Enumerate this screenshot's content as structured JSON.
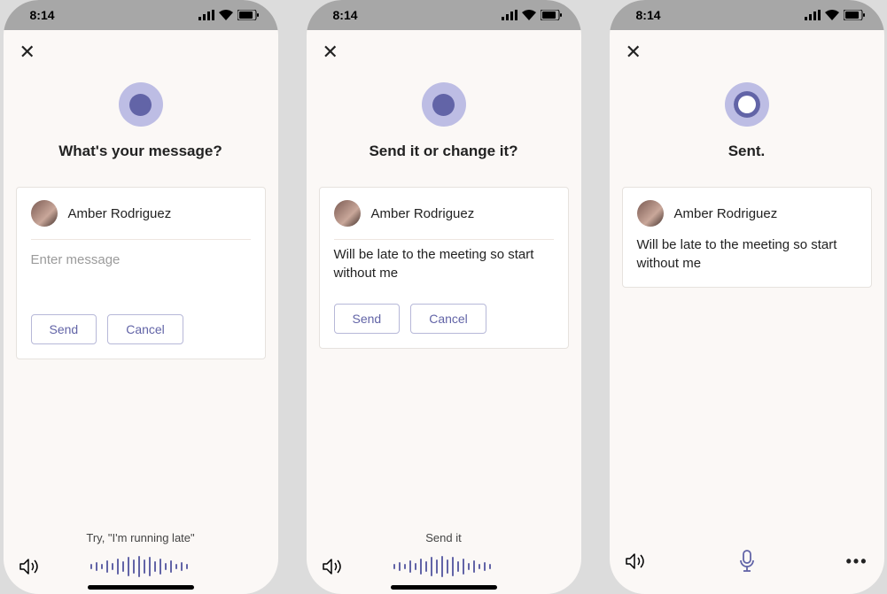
{
  "statusbar": {
    "time": "8:14"
  },
  "screens": [
    {
      "prompt": "What's your message?",
      "recipient": "Amber Rodriguez",
      "placeholder": "Enter message",
      "message": "",
      "send_label": "Send",
      "cancel_label": "Cancel",
      "hint": "Try, \"I'm running late\"",
      "cortana_state": "listening",
      "show_actions": true,
      "show_wave": true,
      "show_mic": false,
      "show_more": false
    },
    {
      "prompt": "Send it or change it?",
      "recipient": "Amber Rodriguez",
      "message": "Will be late to the meeting so start without me",
      "send_label": "Send",
      "cancel_label": "Cancel",
      "hint": "Send it",
      "cortana_state": "listening",
      "show_actions": true,
      "show_wave": true,
      "show_mic": false,
      "show_more": false
    },
    {
      "prompt": "Sent.",
      "recipient": "Amber Rodriguez",
      "message": "Will be late to the meeting so start without me",
      "hint": "",
      "cortana_state": "idle",
      "show_actions": false,
      "show_wave": false,
      "show_mic": true,
      "show_more": true
    }
  ],
  "colors": {
    "accent": "#6264a7",
    "accent_light": "#bdbde4",
    "bg": "#fbf8f6"
  }
}
